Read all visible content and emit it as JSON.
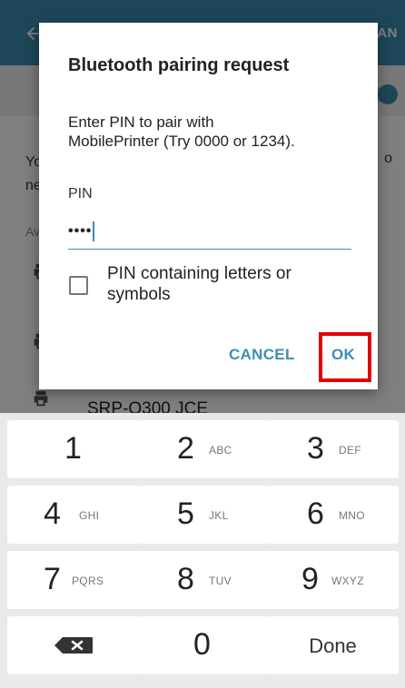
{
  "background": {
    "appbar_action": "AN",
    "visible_text_line1": "Yo",
    "visible_text_line2": "ne",
    "visible_text_right": "o",
    "section_label": "Av",
    "devices": [
      {
        "name": ""
      },
      {
        "name": ""
      },
      {
        "name": "SRP-Q300 JCE"
      }
    ]
  },
  "dialog": {
    "title": "Bluetooth pairing request",
    "message": "Enter PIN to pair with\nMobilePrinter (Try 0000 or 1234).",
    "pin_label": "PIN",
    "pin_value": "••••",
    "checkbox_label": "PIN containing letters or\nsymbols",
    "checkbox_checked": false,
    "cancel_label": "CANCEL",
    "ok_label": "OK"
  },
  "keypad": {
    "keys": [
      {
        "num": "1",
        "letters": ""
      },
      {
        "num": "2",
        "letters": "ABC"
      },
      {
        "num": "3",
        "letters": "DEF"
      },
      {
        "num": "4",
        "letters": "GHI"
      },
      {
        "num": "5",
        "letters": "JKL"
      },
      {
        "num": "6",
        "letters": "MNO"
      },
      {
        "num": "7",
        "letters": "PQRS"
      },
      {
        "num": "8",
        "letters": "TUV"
      },
      {
        "num": "9",
        "letters": "WXYZ"
      },
      {
        "num": "0",
        "letters": ""
      }
    ],
    "done_label": "Done",
    "delete_icon": "backspace-icon"
  },
  "colors": {
    "accent": "#3b8fb0",
    "highlight": "#e00000",
    "keypad_bg": "#e9e9e9"
  }
}
